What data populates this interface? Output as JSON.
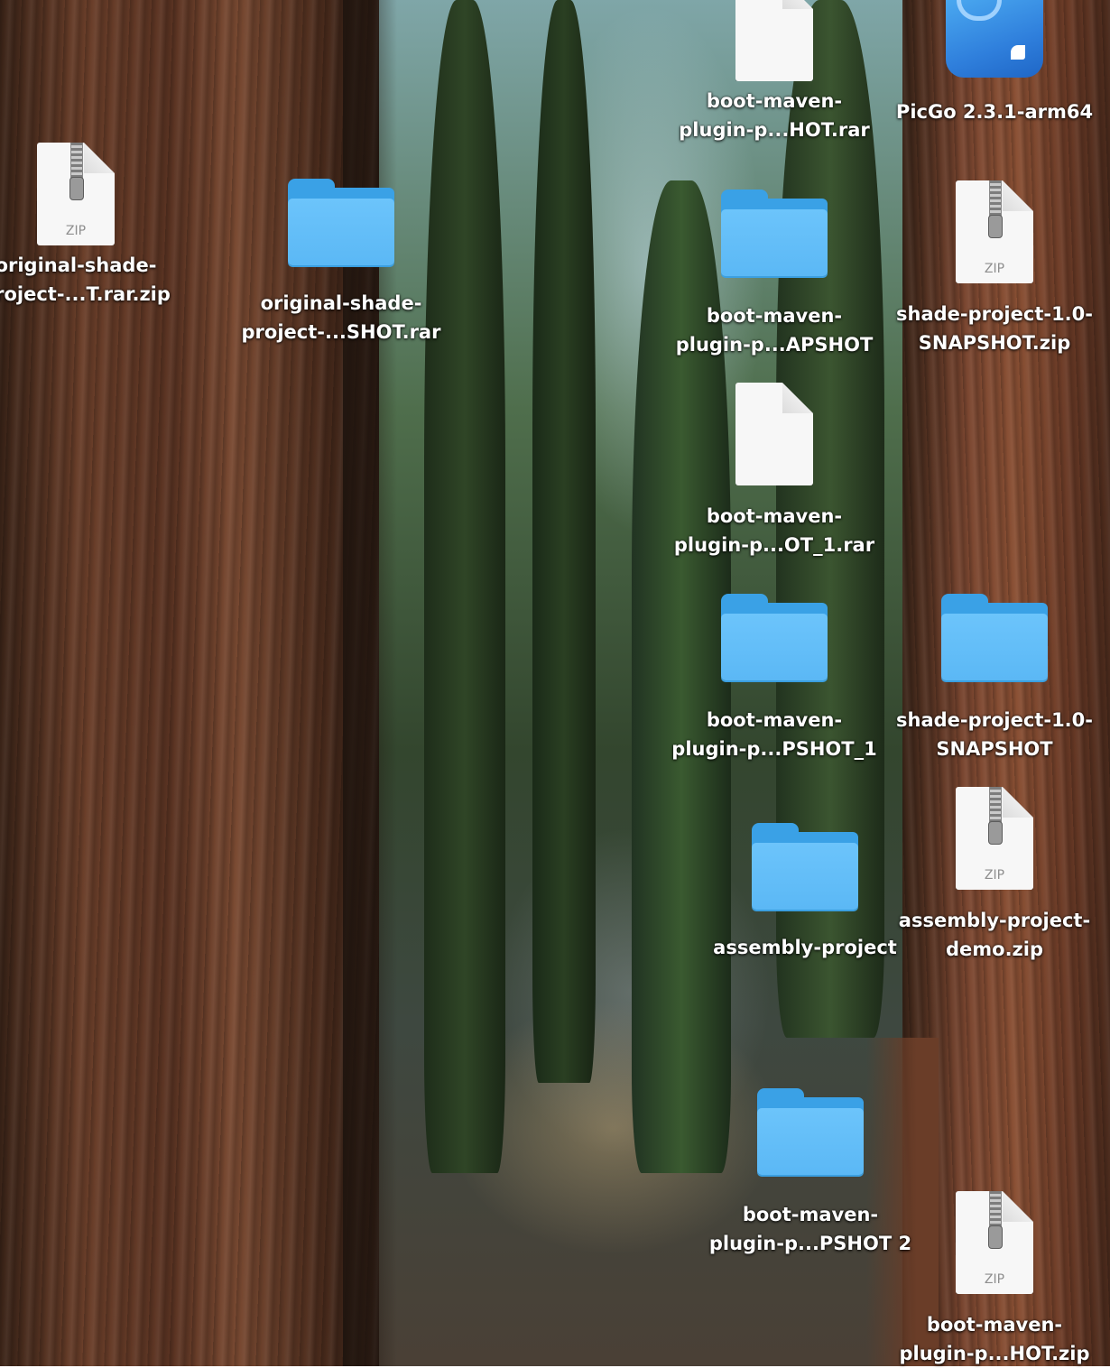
{
  "desktop": {
    "items": [
      {
        "id": "original-shade-project-zip",
        "type": "zip",
        "label": "original-shade-\nproject-...T.rar.zip",
        "zip_text": "ZIP"
      },
      {
        "id": "original-shade-project-folder",
        "type": "folder",
        "label": "original-shade-\nproject-...SHOT.rar"
      },
      {
        "id": "boot-maven-hot-rar",
        "type": "document",
        "label": "boot-maven-\nplugin-p...HOT.rar"
      },
      {
        "id": "picgo",
        "type": "app",
        "label": "PicGo 2.3.1-arm64"
      },
      {
        "id": "boot-maven-apshot-folder",
        "type": "folder",
        "label": "boot-maven-\nplugin-p...APSHOT"
      },
      {
        "id": "shade-project-snapshot-zip",
        "type": "zip",
        "label": "shade-project-1.0-\nSNAPSHOT.zip",
        "zip_text": "ZIP"
      },
      {
        "id": "boot-maven-ot1-rar",
        "type": "document",
        "label": "boot-maven-\nplugin-p...OT_1.rar"
      },
      {
        "id": "boot-maven-pshot1-folder",
        "type": "folder",
        "label": "boot-maven-\nplugin-p...PSHOT_1"
      },
      {
        "id": "shade-project-snapshot-folder",
        "type": "folder",
        "label": "shade-project-1.0-\nSNAPSHOT"
      },
      {
        "id": "assembly-project-folder",
        "type": "folder",
        "label": "assembly-project"
      },
      {
        "id": "assembly-project-demo-zip",
        "type": "zip",
        "label": "assembly-project-\ndemo.zip",
        "zip_text": "ZIP"
      },
      {
        "id": "boot-maven-pshot2-folder",
        "type": "folder",
        "label": "boot-maven-\nplugin-p...PSHOT 2"
      },
      {
        "id": "boot-maven-hot-zip",
        "type": "zip",
        "label": "boot-maven-\nplugin-p...HOT.zip",
        "zip_text": "ZIP"
      }
    ]
  },
  "colors": {
    "folder_front": "#5bb8f5",
    "folder_back": "#3aa1e6",
    "label_text": "#ffffff",
    "app_tile": "#2f7fdc"
  },
  "icons": {
    "folder": "folder-icon",
    "zip": "zip-file-icon",
    "document": "document-icon",
    "app": "picgo-app-icon"
  }
}
